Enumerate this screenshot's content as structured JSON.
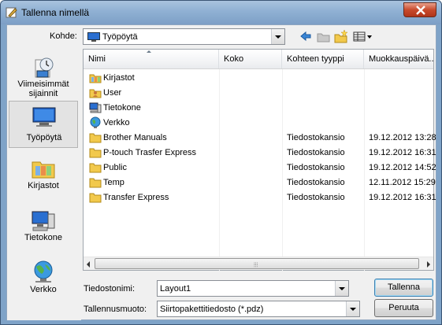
{
  "window": {
    "title": "Tallenna nimellä"
  },
  "toolbar": {
    "lookin_label": "Kohde:",
    "lookin_value": "Työpöytä"
  },
  "places": [
    {
      "label": "Viimeisimmät sijainnit",
      "icon": "recent-places-icon"
    },
    {
      "label": "Työpöytä",
      "icon": "desktop-icon",
      "selected": true
    },
    {
      "label": "Kirjastot",
      "icon": "libraries-icon"
    },
    {
      "label": "Tietokone",
      "icon": "computer-icon"
    },
    {
      "label": "Verkko",
      "icon": "network-icon"
    }
  ],
  "columns": [
    "Nimi",
    "Koko",
    "Kohteen tyyppi",
    "Muokkauspäivä..."
  ],
  "rows": [
    {
      "name": "Kirjastot",
      "size": "",
      "type": "",
      "modified": "",
      "icon": "libraries-icon"
    },
    {
      "name": "User",
      "size": "",
      "type": "",
      "modified": "",
      "icon": "user-folder-icon"
    },
    {
      "name": "Tietokone",
      "size": "",
      "type": "",
      "modified": "",
      "icon": "computer-icon"
    },
    {
      "name": "Verkko",
      "size": "",
      "type": "",
      "modified": "",
      "icon": "network-icon"
    },
    {
      "name": "Brother Manuals",
      "size": "",
      "type": "Tiedostokansio",
      "modified": "19.12.2012 13:28",
      "icon": "folder-icon"
    },
    {
      "name": "P-touch Trasfer Express",
      "size": "",
      "type": "Tiedostokansio",
      "modified": "19.12.2012 16:31",
      "icon": "folder-icon"
    },
    {
      "name": "Public",
      "size": "",
      "type": "Tiedostokansio",
      "modified": "19.12.2012 14:52",
      "icon": "folder-icon"
    },
    {
      "name": "Temp",
      "size": "",
      "type": "Tiedostokansio",
      "modified": "12.11.2012 15:29",
      "icon": "folder-icon"
    },
    {
      "name": "Transfer Express",
      "size": "",
      "type": "Tiedostokansio",
      "modified": "19.12.2012 16:31",
      "icon": "folder-icon"
    }
  ],
  "form": {
    "filename_label": "Tiedostonimi:",
    "filename_value": "Layout1",
    "filetype_label": "Tallennusmuoto:",
    "filetype_value": "Siirtopakettitiedosto (*.pdz)",
    "save_label": "Tallenna",
    "cancel_label": "Peruuta"
  },
  "colors": {
    "folder": "#f2c94c",
    "accent": "#3c7fb1"
  }
}
